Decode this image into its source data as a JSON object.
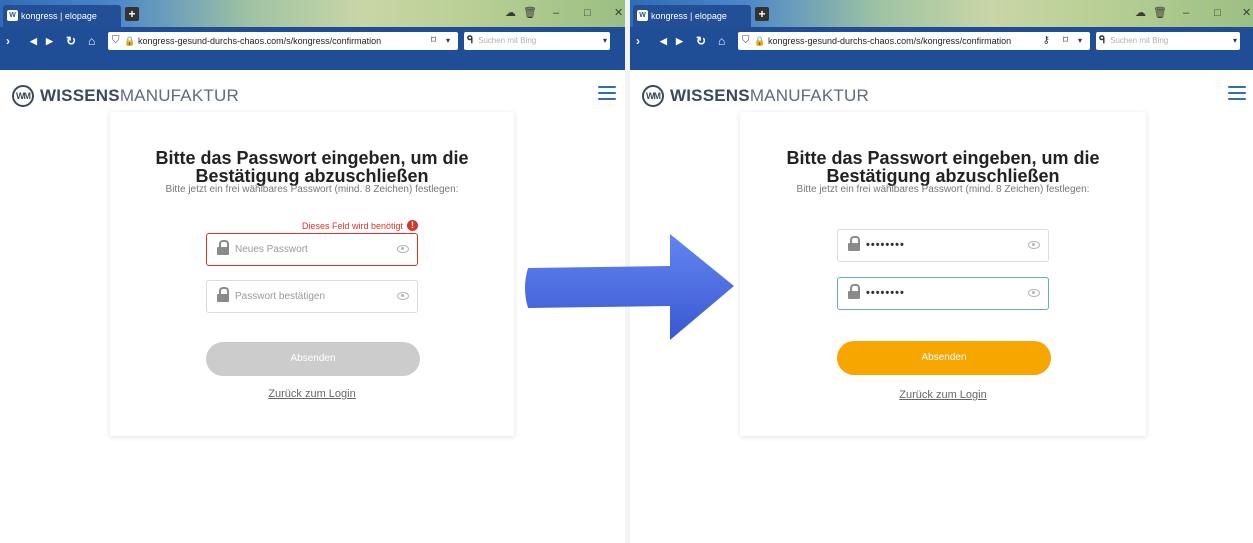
{
  "browser": {
    "tab_title": "kongress | elopage",
    "favicon_text": "W",
    "url": "kongress-gesund-durchs-chaos.com/s/kongress/confirmation",
    "search_placeholder": "Suchen mit Bing"
  },
  "site": {
    "logo_bold": "WISSENS",
    "logo_light": "MANUFAKTUR",
    "logo_mark": "WM"
  },
  "before": {
    "title_line1": "Bitte das Passwort eingeben, um die",
    "title_line2": "Bestätigung abzuschließen",
    "subtitle": "Bitte jetzt ein frei wählbares Passwort (mind. 8 Zeichen) festlegen:",
    "error_message": "Dieses Feld wird benötigt",
    "new_password_placeholder": "Neues Passwort",
    "confirm_password_placeholder": "Passwort bestätigen",
    "submit_label": "Absenden",
    "back_link": "Zurück zum Login"
  },
  "after": {
    "title_line1": "Bitte das Passwort eingeben, um die",
    "title_line2": "Bestätigung abzuschließen",
    "subtitle": "Bitte jetzt ein frei wählbares Passwort (mind. 8 Zeichen) festlegen:",
    "new_password_value": "••••••••",
    "confirm_password_value": "••••••••",
    "submit_label": "Absenden",
    "back_link": "Zurück zum Login"
  },
  "colors": {
    "brand_blue": "#1f4e96",
    "accent_orange": "#f7a600",
    "error_red": "#d9342b",
    "disabled_gray": "#cccccc",
    "arrow_blue": "#3b5fe0"
  }
}
